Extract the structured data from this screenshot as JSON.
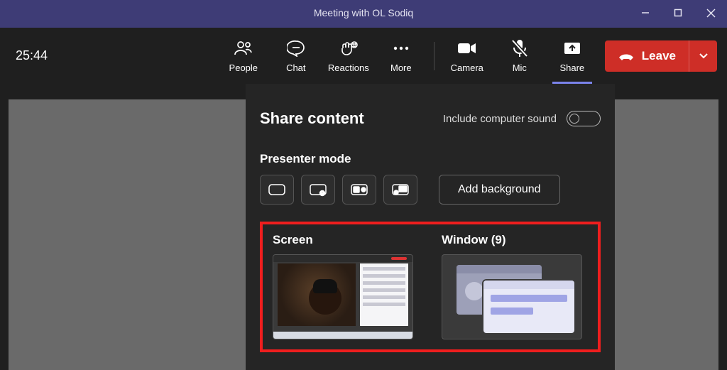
{
  "titlebar": {
    "title": "Meeting with OL Sodiq"
  },
  "timer": "25:44",
  "toolbar": {
    "people": "People",
    "chat": "Chat",
    "reactions": "Reactions",
    "more": "More",
    "camera": "Camera",
    "mic": "Mic",
    "share": "Share",
    "leave": "Leave"
  },
  "sharePanel": {
    "title": "Share content",
    "includeSoundLabel": "Include computer sound",
    "includeSoundOn": false,
    "presenterModeLabel": "Presenter mode",
    "addBackground": "Add background",
    "screenLabel": "Screen",
    "windowLabel": "Window (9)"
  }
}
